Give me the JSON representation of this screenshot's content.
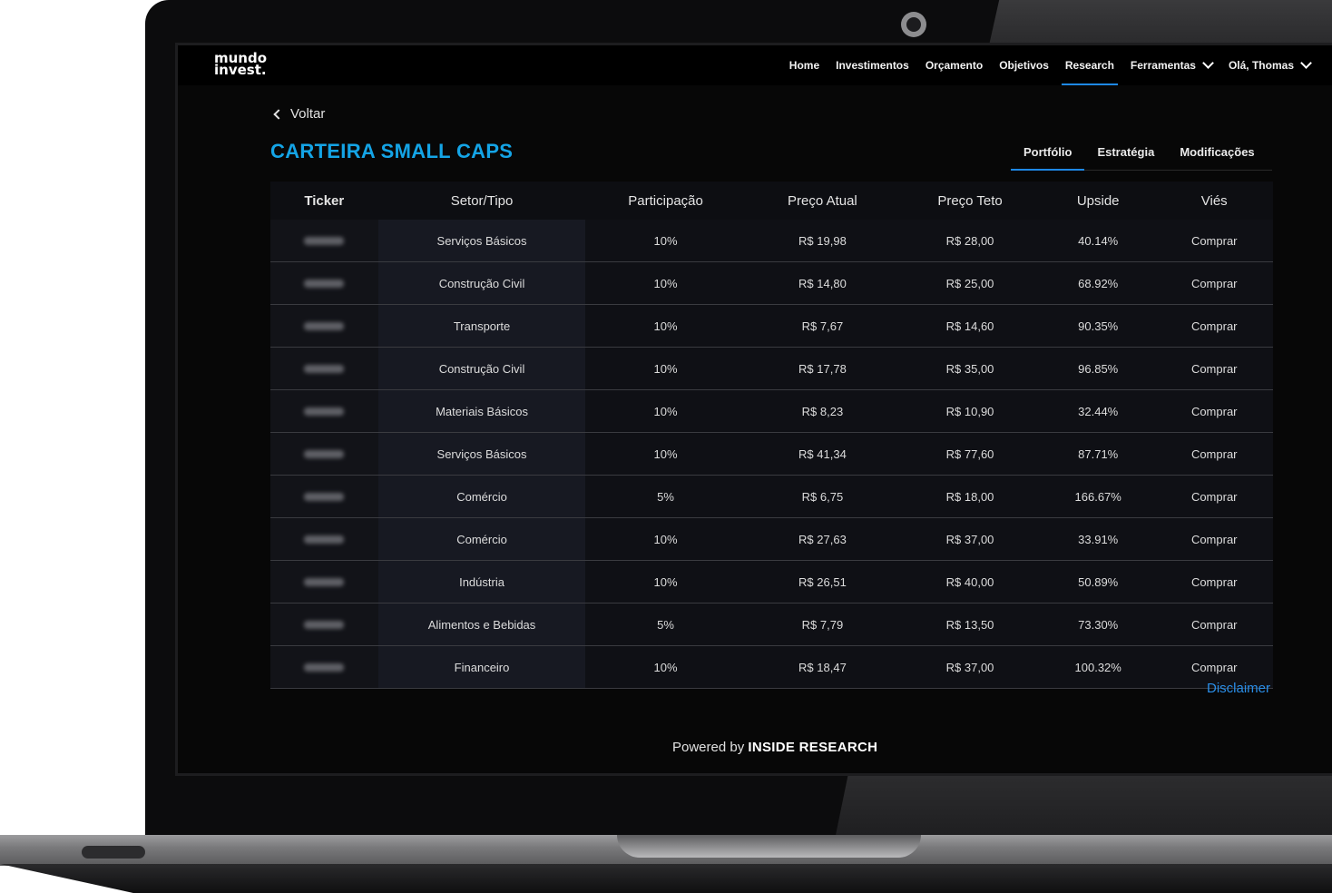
{
  "app": {
    "logo_line1": "mundo",
    "logo_line2": "invest."
  },
  "nav": {
    "items": [
      {
        "label": "Home"
      },
      {
        "label": "Investimentos"
      },
      {
        "label": "Orçamento"
      },
      {
        "label": "Objetivos"
      },
      {
        "label": "Research",
        "active": true
      },
      {
        "label": "Ferramentas",
        "dropdown": true
      }
    ],
    "user_greeting": "Olá, Thomas"
  },
  "back_label": "Voltar",
  "page_title": "CARTEIRA SMALL CAPS",
  "tabs": [
    {
      "label": "Portfólio",
      "active": true
    },
    {
      "label": "Estratégia"
    },
    {
      "label": "Modificações"
    }
  ],
  "table": {
    "columns": [
      "Ticker",
      "Setor/Tipo",
      "Participação",
      "Preço Atual",
      "Preço Teto",
      "Upside",
      "Viés"
    ],
    "rows": [
      {
        "sector": "Serviços Básicos",
        "part": "10%",
        "preco_atual": "R$ 19,98",
        "preco_teto": "R$ 28,00",
        "upside": "40.14%",
        "vies": "Comprar"
      },
      {
        "sector": "Construção Civil",
        "part": "10%",
        "preco_atual": "R$ 14,80",
        "preco_teto": "R$ 25,00",
        "upside": "68.92%",
        "vies": "Comprar"
      },
      {
        "sector": "Transporte",
        "part": "10%",
        "preco_atual": "R$ 7,67",
        "preco_teto": "R$ 14,60",
        "upside": "90.35%",
        "vies": "Comprar"
      },
      {
        "sector": "Construção Civil",
        "part": "10%",
        "preco_atual": "R$ 17,78",
        "preco_teto": "R$ 35,00",
        "upside": "96.85%",
        "vies": "Comprar"
      },
      {
        "sector": "Materiais Básicos",
        "part": "10%",
        "preco_atual": "R$ 8,23",
        "preco_teto": "R$ 10,90",
        "upside": "32.44%",
        "vies": "Comprar"
      },
      {
        "sector": "Serviços Básicos",
        "part": "10%",
        "preco_atual": "R$ 41,34",
        "preco_teto": "R$ 77,60",
        "upside": "87.71%",
        "vies": "Comprar"
      },
      {
        "sector": "Comércio",
        "part": "5%",
        "preco_atual": "R$ 6,75",
        "preco_teto": "R$ 18,00",
        "upside": "166.67%",
        "vies": "Comprar"
      },
      {
        "sector": "Comércio",
        "part": "10%",
        "preco_atual": "R$ 27,63",
        "preco_teto": "R$ 37,00",
        "upside": "33.91%",
        "vies": "Comprar"
      },
      {
        "sector": "Indústria",
        "part": "10%",
        "preco_atual": "R$ 26,51",
        "preco_teto": "R$ 40,00",
        "upside": "50.89%",
        "vies": "Comprar"
      },
      {
        "sector": "Alimentos e Bebidas",
        "part": "5%",
        "preco_atual": "R$ 7,79",
        "preco_teto": "R$ 13,50",
        "upside": "73.30%",
        "vies": "Comprar"
      },
      {
        "sector": "Financeiro",
        "part": "10%",
        "preco_atual": "R$ 18,47",
        "preco_teto": "R$ 37,00",
        "upside": "100.32%",
        "vies": "Comprar"
      }
    ]
  },
  "disclaimer": "Disclaimer",
  "footer": {
    "powered_prefix": "Powered by",
    "powered_brand": "INSIDE RESEARCH"
  }
}
